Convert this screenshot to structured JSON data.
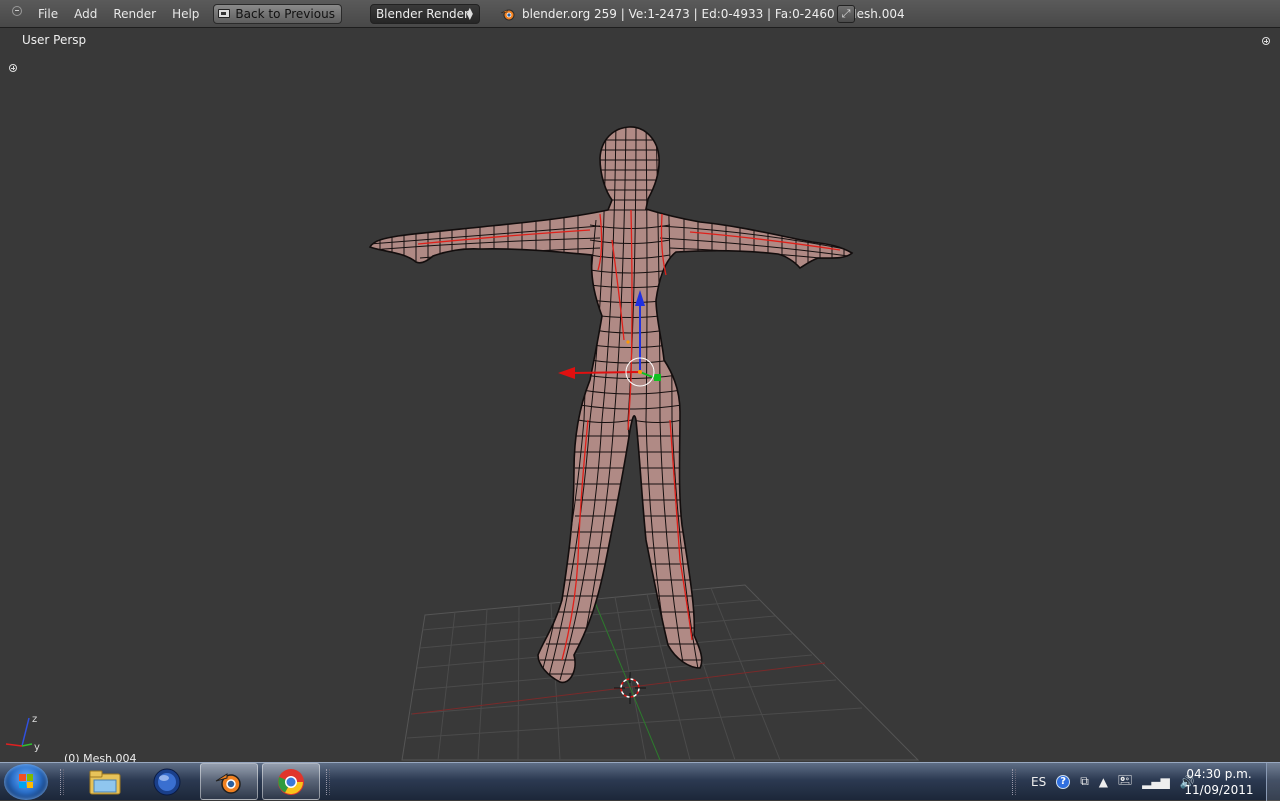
{
  "header": {
    "menu": [
      "File",
      "Add",
      "Render",
      "Help"
    ],
    "back_button": "Back to Previous",
    "render_engine": "Blender Render",
    "stats": "blender.org 259 | Ve:1-2473 | Ed:0-4933 | Fa:0-2460 | Mesh.004"
  },
  "viewport": {
    "view_name": "User Persp",
    "object_label": "(0) Mesh.004",
    "axis_y_label": "y",
    "axis_z_label": "z",
    "icons": [
      "collapse-icon",
      "plus-icon",
      "fullscreen-icon"
    ],
    "colors": {
      "background": "#393939",
      "mesh_fill": "#b08a85",
      "wire": "#151010",
      "seam": "#e0201a",
      "gizmo_x": "#e01010",
      "gizmo_y": "#10c020",
      "gizmo_z": "#2030e0"
    }
  },
  "taskbar": {
    "apps": [
      "start-button",
      "file-explorer",
      "blender-app-icon",
      "blender",
      "chrome"
    ],
    "language": "ES",
    "time": "04:30 p.m.",
    "date": "11/09/2011"
  }
}
